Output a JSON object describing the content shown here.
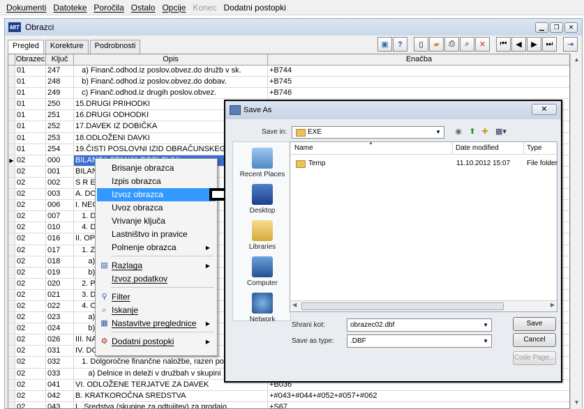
{
  "menubar": {
    "items": [
      "Dokumenti",
      "Datoteke",
      "Poročila",
      "Ostalo",
      "Opcije",
      "Konec",
      "Dodatni postopki"
    ]
  },
  "window": {
    "logo": "MIT",
    "title": "Obrazci"
  },
  "tabs": [
    "Pregled",
    "Korekture",
    "Podrobnosti"
  ],
  "grid": {
    "headers": [
      "Obrazec",
      "Ključ",
      "Opis",
      "Enačba"
    ],
    "rows": [
      [
        "01",
        "247",
        "   a) Finanč.odhod.iz poslov.obvez.do družb v sk.",
        "+B744"
      ],
      [
        "01",
        "248",
        "   b) Finanč.odhod.iz poslov.obvez.do dobav.",
        "+B745"
      ],
      [
        "01",
        "249",
        "   c) Finanč.odhod.iz drugih poslov.obvez.",
        "+B746"
      ],
      [
        "01",
        "250",
        "15.DRUGI PRIHODKI",
        ""
      ],
      [
        "01",
        "251",
        "16.DRUGI ODHODKI",
        ""
      ],
      [
        "01",
        "252",
        "17.DAVEK IZ DOBIČKA",
        ""
      ],
      [
        "01",
        "253",
        "18.ODLOŽENI DAVKI",
        ""
      ],
      [
        "01",
        "254",
        "19.ČISTI POSLOVNI IZID OBRAČUNSKEGA O",
        ""
      ],
      [
        "02",
        "000",
        "BILANCA STANJA POSLOVNI",
        ""
      ],
      [
        "02",
        "001",
        "BILANC",
        ""
      ],
      [
        "02",
        "002",
        "S R E D",
        ""
      ],
      [
        "02",
        "003",
        "A. DOLG",
        ""
      ],
      [
        "02",
        "006",
        "I. NEOB",
        ""
      ],
      [
        "02",
        "007",
        "   1. Do",
        ""
      ],
      [
        "02",
        "010",
        "   4. Do",
        ""
      ],
      [
        "02",
        "016",
        "II. OPRE",
        ""
      ],
      [
        "02",
        "017",
        "   1. Ze",
        ""
      ],
      [
        "02",
        "018",
        "      a)",
        ""
      ],
      [
        "02",
        "019",
        "      b)",
        ""
      ],
      [
        "02",
        "020",
        "   2. Pro",
        ""
      ],
      [
        "02",
        "021",
        "   3. Dr",
        ""
      ],
      [
        "02",
        "022",
        "   4. Os",
        ""
      ],
      [
        "02",
        "023",
        "      a)",
        ""
      ],
      [
        "02",
        "024",
        "      b)",
        ""
      ],
      [
        "02",
        "026",
        "III. NAL",
        ""
      ],
      [
        "02",
        "031",
        "IV. DOL",
        ""
      ],
      [
        "02",
        "032",
        "   1. Dolgoročne finančne naložbe, razen posoj",
        ""
      ],
      [
        "02",
        "033",
        "      a) Delnice in deleži v družbah v skupini",
        ""
      ],
      [
        "02",
        "041",
        "VI. ODLOŽENE TERJATVE ZA DAVEK",
        "+B036"
      ],
      [
        "02",
        "042",
        "B. KRATKOROČNA SREDSTVA",
        "+#043+#044+#052+#057+#062"
      ],
      [
        "02",
        "043",
        "I.  Sredstva (skupine za odtujitev) za prodajo",
        "+S67"
      ]
    ]
  },
  "context_menu": {
    "items": [
      {
        "label": "Brisanje obrazca",
        "icon": ""
      },
      {
        "label": "Izpis obrazca",
        "icon": ""
      },
      {
        "label": "Izvoz obrazca",
        "icon": ""
      },
      {
        "label": "Uvoz obrazca",
        "icon": ""
      },
      {
        "label": "Vrivanje ključa",
        "icon": ""
      },
      {
        "label": "Lastništvo in pravice",
        "icon": ""
      },
      {
        "label": "Polnenje obrazca",
        "icon": ""
      },
      {
        "label": "Razlaga",
        "icon": "document-icon"
      },
      {
        "label": "Izvoz podatkov",
        "icon": ""
      },
      {
        "label": "Filter",
        "icon": "filter-icon"
      },
      {
        "label": "Iskanje",
        "icon": "magnifier-icon"
      },
      {
        "label": "Nastavitve preglednice",
        "icon": "settings-icon"
      },
      {
        "label": "Dodatni postopki",
        "icon": "gear-icon"
      }
    ]
  },
  "save_dialog": {
    "title": "Save As",
    "close": "✕",
    "save_in_label": "Save in:",
    "save_in_value": "EXE",
    "places": [
      "Recent Places",
      "Desktop",
      "Libraries",
      "Computer",
      "Network"
    ],
    "columns": [
      "Name",
      "Date modified",
      "Type"
    ],
    "files": [
      {
        "name": "Temp",
        "modified": "11.10.2012 15:07",
        "type": "File folder"
      }
    ],
    "filename_label": "Shrani kot:",
    "filename_value": "obrazec02.dbf",
    "type_label": "Save as type:",
    "type_value": ".DBF",
    "buttons": {
      "save": "Save",
      "cancel": "Cancel",
      "codepage": "Code Page..."
    }
  },
  "colors": {
    "selection": "#3b6fd1",
    "menu_highlight": "#3399ff"
  }
}
